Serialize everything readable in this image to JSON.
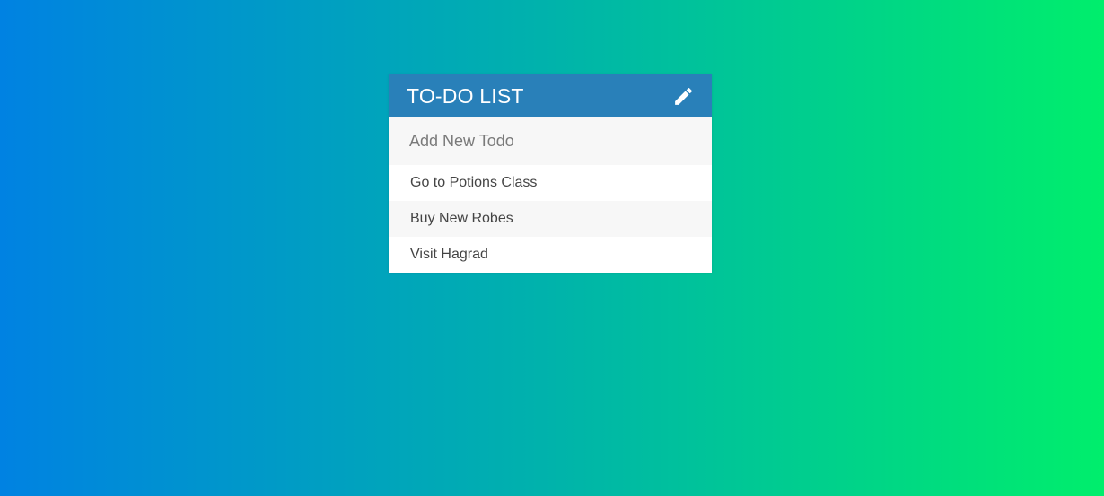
{
  "colors": {
    "gradient_start": "#0082e2",
    "gradient_end": "#00ee6c",
    "header_bg": "#2980b9",
    "input_bg": "#f7f7f7",
    "text": "#444444"
  },
  "header": {
    "title": "TO-DO LIST",
    "toggle_icon": "pencil-icon"
  },
  "new_todo": {
    "value": "",
    "placeholder": "Add New Todo"
  },
  "todos": [
    {
      "text": "Go to Potions Class"
    },
    {
      "text": "Buy New Robes"
    },
    {
      "text": "Visit Hagrad"
    }
  ]
}
